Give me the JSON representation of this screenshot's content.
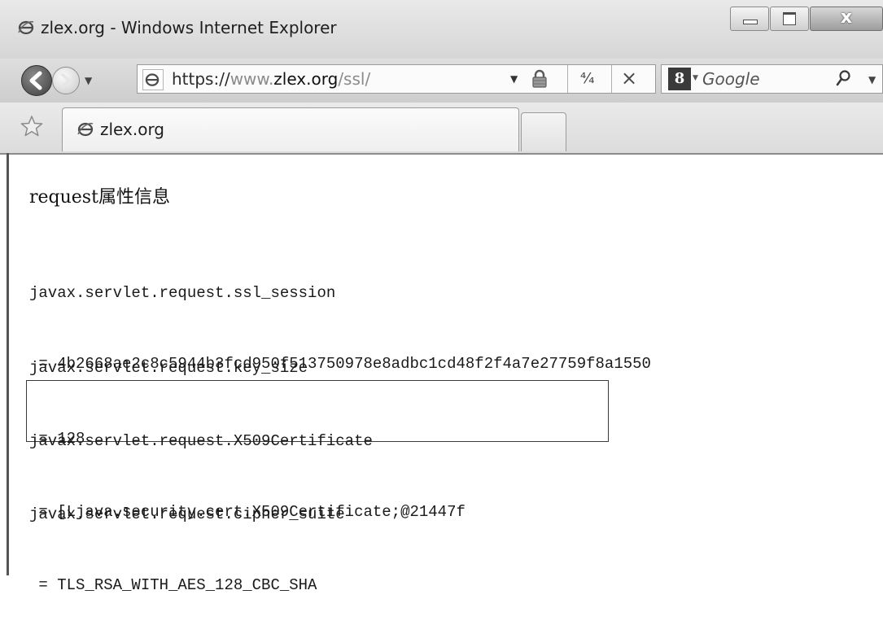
{
  "window": {
    "title": "zlex.org - Windows Internet Explorer",
    "controls": {
      "minimize": "minimize",
      "maximize": "maximize",
      "close_label": "x"
    }
  },
  "navigation": {
    "back_icon": "back-arrow-icon",
    "forward_icon": "forward-arrow-icon",
    "address": {
      "protocol": "https://",
      "host": "www.zlex.org",
      "path": "/ssl/",
      "security_icon": "lock-icon"
    },
    "refresh_icon": "refresh-icon",
    "stop_label": "×",
    "search": {
      "provider_label": "8",
      "placeholder": "Google"
    }
  },
  "tabs": [
    {
      "title": "zlex.org",
      "active": true
    }
  ],
  "page": {
    "heading": "request属性信息",
    "attributes": [
      {
        "name": "javax.servlet.request.ssl_session",
        "value": " = 4b2668ae2c8c5944b3fcd950f513750978e8adbc1cd48f2f4a7e27759f8a1550"
      },
      {
        "name": "javax.servlet.request.key_size",
        "value": " = 128"
      },
      {
        "name": "javax.servlet.request.X509Certificate",
        "value": " = [Ljava.security.cert.X509Certificate;@21447f",
        "highlighted": true
      },
      {
        "name": "javax.servlet.request.cipher_suite",
        "value": " = TLS_RSA_WITH_AES_128_CBC_SHA"
      }
    ]
  }
}
